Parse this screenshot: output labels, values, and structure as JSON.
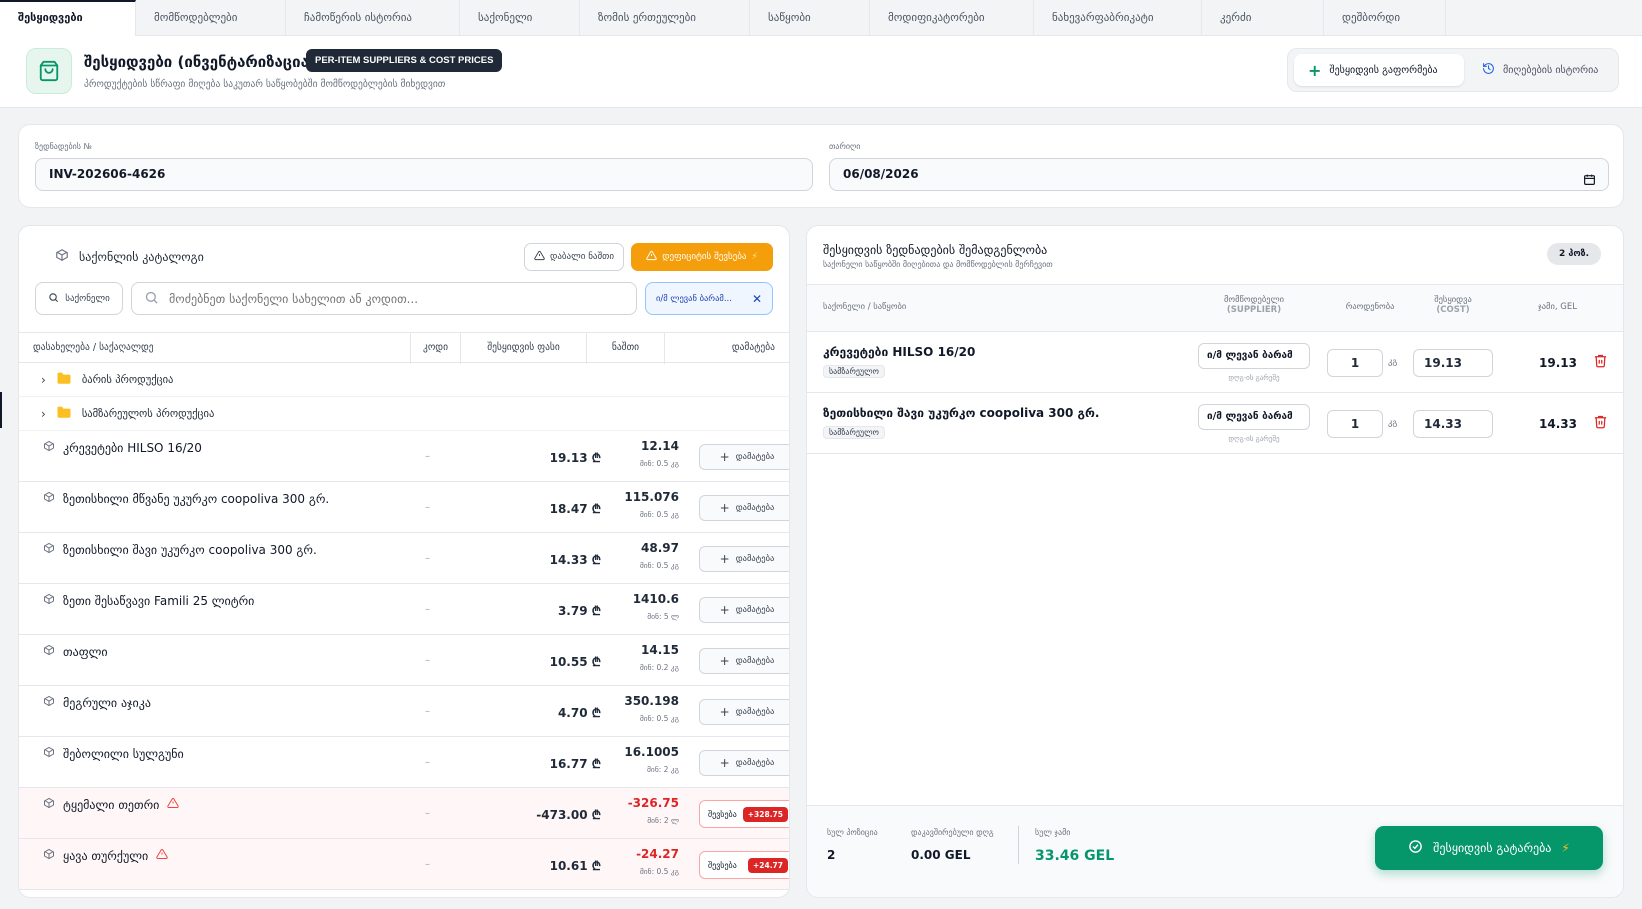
{
  "tabs": [
    {
      "label": "შესყიდვები",
      "active": true,
      "w": 136
    },
    {
      "label": "მომწოდებლები",
      "w": 150
    },
    {
      "label": "ჩამოწერის ისტორია",
      "w": 174
    },
    {
      "label": "საქონელი",
      "w": 120
    },
    {
      "label": "ზომის ერთეულები",
      "w": 170
    },
    {
      "label": "საწყობი",
      "w": 120
    },
    {
      "label": "მოდიფიკატორები",
      "w": 164
    },
    {
      "label": "ნახევარფაბრიკატი",
      "w": 168
    },
    {
      "label": "კერძი",
      "w": 122
    },
    {
      "label": "დეშბორდი",
      "w": 122
    }
  ],
  "header": {
    "title": "შესყიდვები (ინვენტარიზაცია)",
    "badge": "PER-ITEM SUPPLIERS & COST PRICES",
    "subtitle": "პროდუქტების სწრაფი მიღება საკუთარ საწყობებში მომწოდებლების მიხედვით",
    "primary_button": "შესყიდვის გაფორმება",
    "secondary_button": "მიღებების ისტორია"
  },
  "invoice": {
    "number_label": "ზედნადების №",
    "number_value": "INV-202606-4626",
    "date_label": "თარიღი",
    "date_value": "06/08/2026"
  },
  "catalog": {
    "title": "საქონლის კატალოგი",
    "low_stock_button": "დაბალი ნაშთი",
    "negative_button": "დეფიციტის შევსება",
    "filter_button": "საქონელი",
    "search_placeholder": "მოძებნეთ საქონელი სახელით ან კოდით...",
    "supplier_chip": "ი/მ ლევან ბარამ...",
    "columns": {
      "name": "დასახელება / საქაღალდე",
      "code": "კოდი",
      "price": "შესყიდვის ფასი",
      "stock": "ნაშთი",
      "add": "დამატება"
    },
    "folders": [
      "ბარის პროდუქცია",
      "სამზარეულოს პროდუქცია"
    ],
    "add_label": "დამატება",
    "fix_label": "შევსება",
    "items": [
      {
        "name": "კრევეტები HILSO 16/20",
        "code": "–",
        "price": "19.13 ₾",
        "stock": "12.14",
        "min": "მინ: 0.5 კგ",
        "warn": false
      },
      {
        "name": "ზეთისხილი მწვანე უკურკო coopoliva 300 გრ.",
        "code": "–",
        "price": "18.47 ₾",
        "stock": "115.076",
        "min": "მინ: 0.5 კგ",
        "warn": false
      },
      {
        "name": "ზეთისხილი შავი უკურკო coopoliva 300 გრ.",
        "code": "–",
        "price": "14.33 ₾",
        "stock": "48.97",
        "min": "მინ: 0.5 კგ",
        "warn": false
      },
      {
        "name": "ზეთი შესაწვავი Famili 25 ლიტრი",
        "code": "–",
        "price": "3.79 ₾",
        "stock": "1410.6",
        "min": "მინ: 5 ლ",
        "warn": false
      },
      {
        "name": "თაფლი",
        "code": "–",
        "price": "10.55 ₾",
        "stock": "14.15",
        "min": "მინ: 0.2 კგ",
        "warn": false
      },
      {
        "name": "მეგრული აჯიკა",
        "code": "–",
        "price": "4.70 ₾",
        "stock": "350.198",
        "min": "მინ: 0.5 კგ",
        "warn": false
      },
      {
        "name": "შებოლილი სულგუნი",
        "code": "–",
        "price": "16.77 ₾",
        "stock": "16.1005",
        "min": "მინ: 2 კგ",
        "warn": false
      },
      {
        "name": "ტყემალი თეთრი",
        "code": "–",
        "price": "-473.00 ₾",
        "stock": "-326.75",
        "min": "მინ: 2 ლ",
        "warn": true,
        "fix": "+328.75"
      },
      {
        "name": "ყავა თურქული",
        "code": "–",
        "price": "10.61 ₾",
        "stock": "-24.27",
        "min": "მინ: 0.5 კგ",
        "warn": true,
        "fix": "+24.77"
      }
    ]
  },
  "cart": {
    "title": "შესყიდვის ზედნადების შემადგენლობა",
    "subtitle": "საქონელი საწყობში მიღებითა და მომწოდებლის მერჩევით",
    "count": "2 პოზ.",
    "columns": {
      "item": "საქონელი / საწყობი",
      "supplier": "მომწოდებელი",
      "supplier_en": "(SUPPLIER)",
      "qty": "რაოდენობა",
      "cost": "შესყიდვა",
      "cost_en": "(COST)",
      "total": "ჯამი, GEL"
    },
    "items": [
      {
        "name": "კრევეტები HILSO 16/20",
        "category": "სამზარეულო",
        "supplier": "ი/მ ლევან ბარამ",
        "supplier_hint": "დღგ-ის გარეშე",
        "qty": "1",
        "unit": "კგ",
        "cost": "19.13",
        "total": "19.13"
      },
      {
        "name": "ზეთისხილი შავი უკურკო coopoliva 300 გრ.",
        "category": "სამზარეულო",
        "supplier": "ი/მ ლევან ბარამ",
        "supplier_hint": "დღგ-ის გარეშე",
        "qty": "1",
        "unit": "კგ",
        "cost": "14.33",
        "total": "14.33"
      }
    ],
    "footer": {
      "positions_label": "სულ პოზიცია",
      "positions_value": "2",
      "vat_label": "დაკავშირებული დღგ",
      "vat_value": "0.00 GEL",
      "total_label": "სულ ჯამი",
      "total_value": "33.46 GEL",
      "checkout_button": "შესყიდვის გატარება"
    }
  },
  "colors": {
    "accent": "#059669",
    "warning": "#f59e0b",
    "danger": "#dc2626",
    "dark": "#1f2937"
  }
}
